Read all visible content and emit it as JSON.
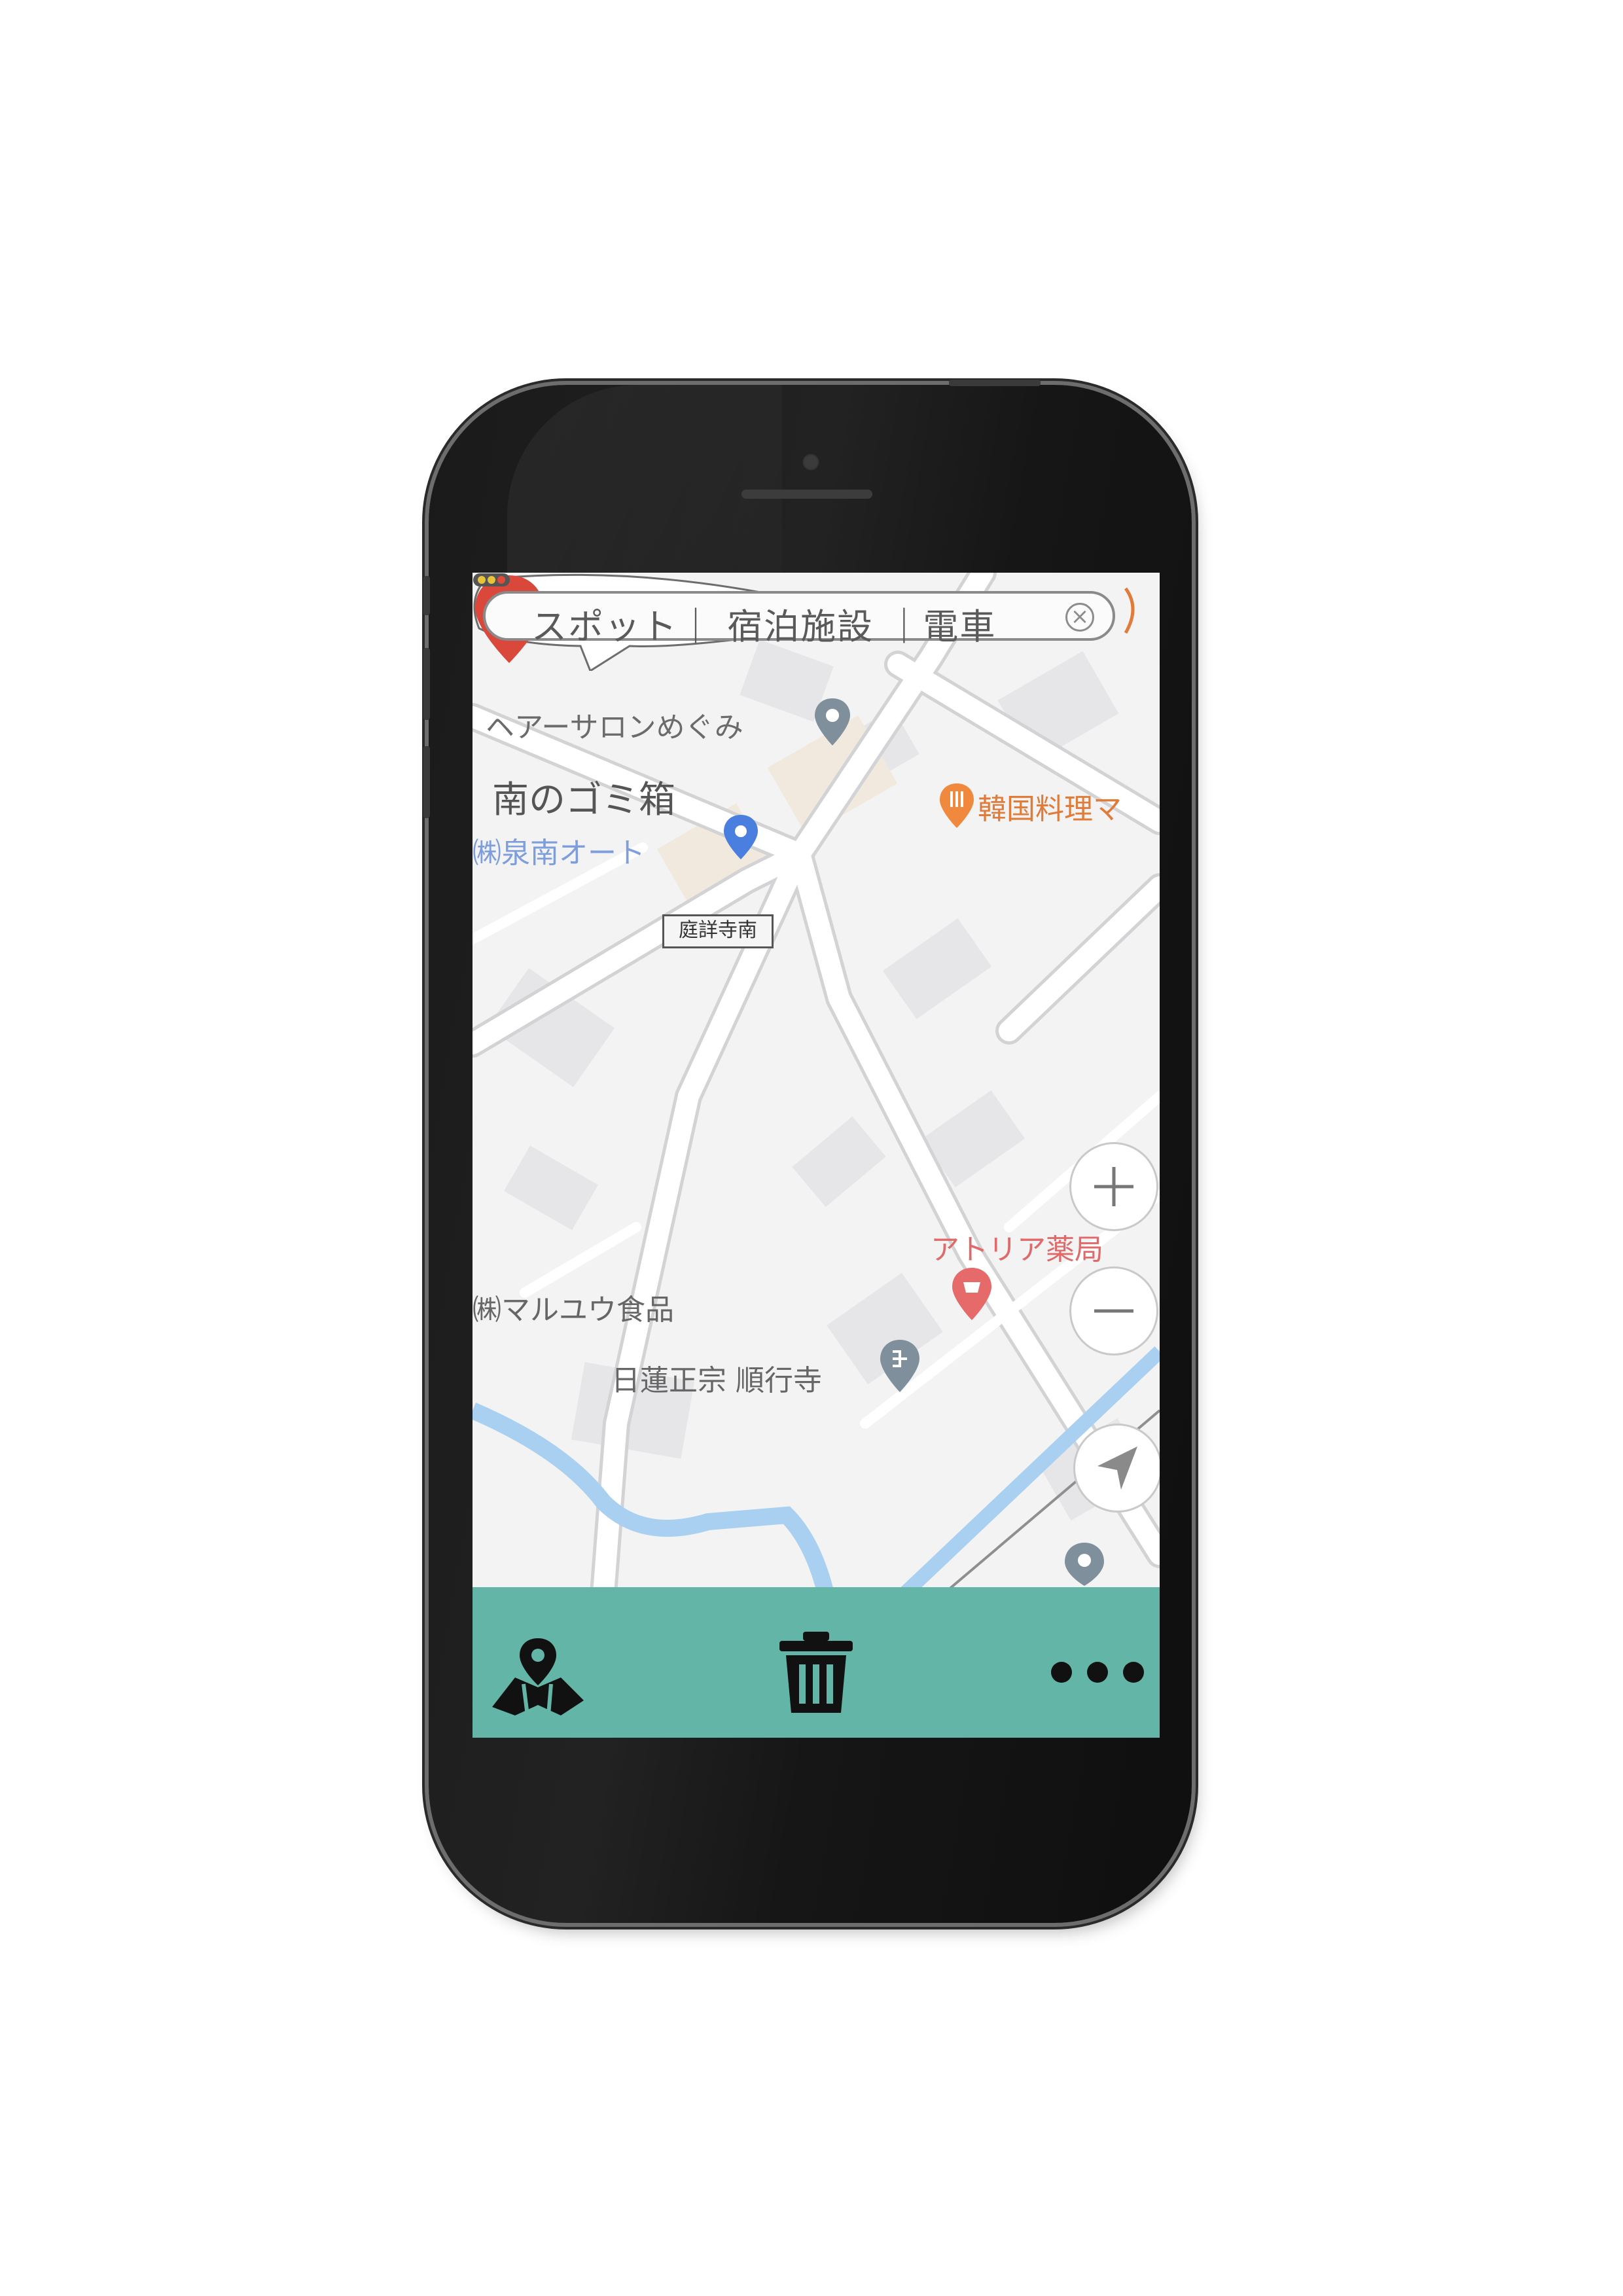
{
  "search": {
    "text": "スポット｜ 宿泊施設 ｜電車",
    "clear_icon": "close-circle-icon"
  },
  "marker_bubble": {
    "label": "南のゴミ箱"
  },
  "intersection_sign": {
    "label": "庭詳寺南"
  },
  "pois": [
    {
      "label": "ヘアーサロンめぐみ",
      "color": "#6b6b6b",
      "icon": "location-pin-icon"
    },
    {
      "label": "韓国料理マ",
      "color": "#e07b39",
      "icon": "restaurant-icon"
    },
    {
      "label": "㈱泉南オート",
      "color": "#6a8fd8",
      "icon": "location-pin-icon"
    },
    {
      "label": "アトリア薬局",
      "color": "#e06a6a",
      "icon": "pharmacy-icon"
    },
    {
      "label": "㈱マルユウ食品",
      "color": "#666666",
      "icon": ""
    },
    {
      "label": "日蓮正宗 順行寺",
      "color": "#666666",
      "icon": "temple-icon"
    }
  ],
  "map_controls": {
    "zoom_in_icon": "plus-icon",
    "zoom_out_icon": "minus-icon",
    "locate_icon": "navigation-arrow-icon"
  },
  "bottom_nav": {
    "items": [
      {
        "icon": "map-pin-icon"
      },
      {
        "icon": "trash-icon"
      },
      {
        "icon": "more-dots-icon"
      }
    ],
    "background": "#63b5a7"
  },
  "colors": {
    "pin": "#d9483b",
    "river": "#a9d0f1",
    "road": "#ffffff",
    "map_background": "#f3f3f4"
  }
}
